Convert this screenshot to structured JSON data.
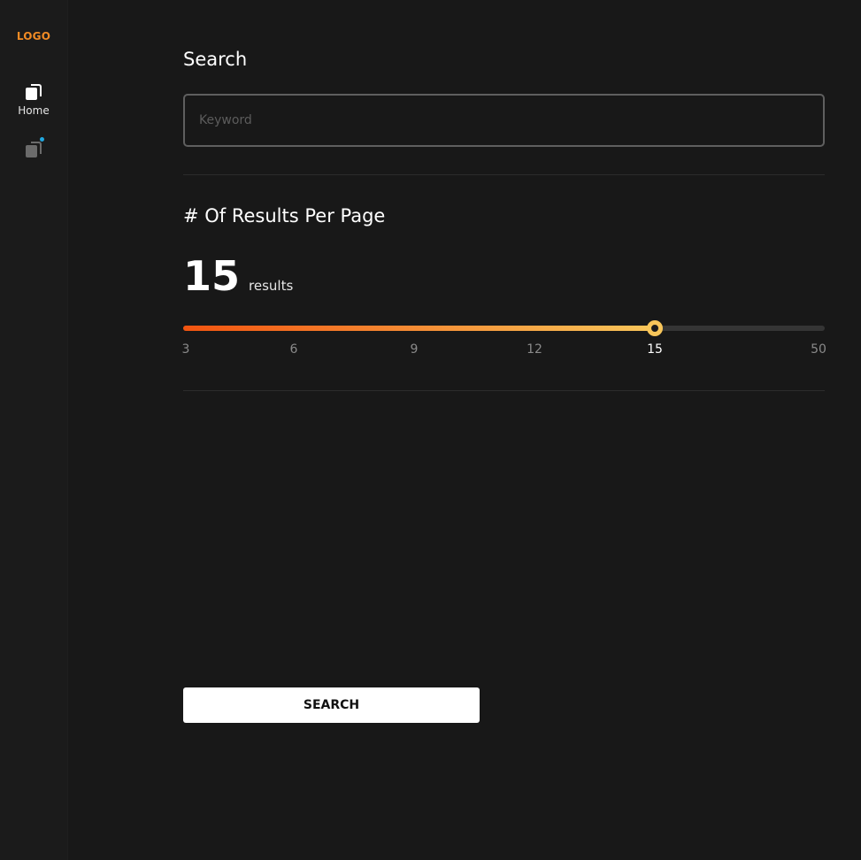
{
  "colors": {
    "background": "#181818",
    "sidebar": "#1b1b1b",
    "logo": "#f08a24",
    "notification_dot": "#21a8e0",
    "slider_start": "#f25410",
    "slider_end": "#f8c65a",
    "slider_track": "#353535",
    "button_bg": "#ffffff"
  },
  "sidebar": {
    "logo": "LOGO",
    "items": [
      {
        "label": "Home",
        "icon": "copy-stack-icon",
        "active": true
      },
      {
        "label": "",
        "icon": "copy-stack-icon",
        "active": false,
        "notification": true
      }
    ]
  },
  "search": {
    "title": "Search",
    "placeholder": "Keyword",
    "value": ""
  },
  "results_per_page": {
    "title": "# Of Results Per Page",
    "value": "15",
    "unit": "results",
    "ticks": [
      "3",
      "6",
      "9",
      "12",
      "15",
      "50"
    ],
    "selected_index": 4
  },
  "actions": {
    "search_label": "SEARCH"
  }
}
